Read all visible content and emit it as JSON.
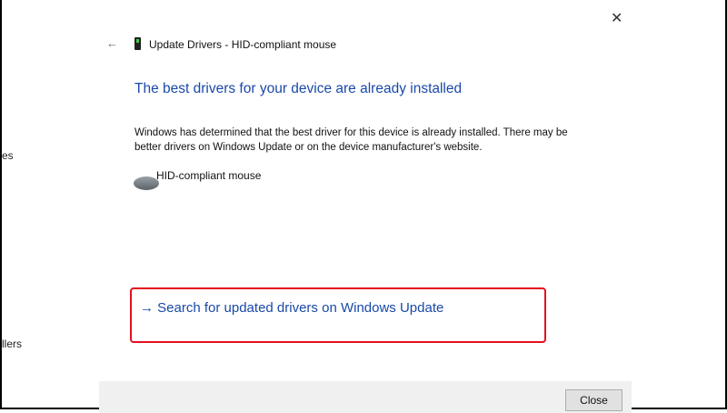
{
  "background": {
    "fragment_1": "es",
    "fragment_2": "llers"
  },
  "dialog": {
    "title": "Update Drivers - HID-compliant mouse",
    "heading": "The best drivers for your device are already installed",
    "description": "Windows has determined that the best driver for this device is already installed. There may be better drivers on Windows Update or on the device manufacturer's website.",
    "device_name": "HID-compliant mouse",
    "link": "→ Search for updated drivers on Windows Update",
    "close_button": "Close"
  },
  "colors": {
    "accent": "#1a49a8",
    "highlight": "#e3101f"
  }
}
